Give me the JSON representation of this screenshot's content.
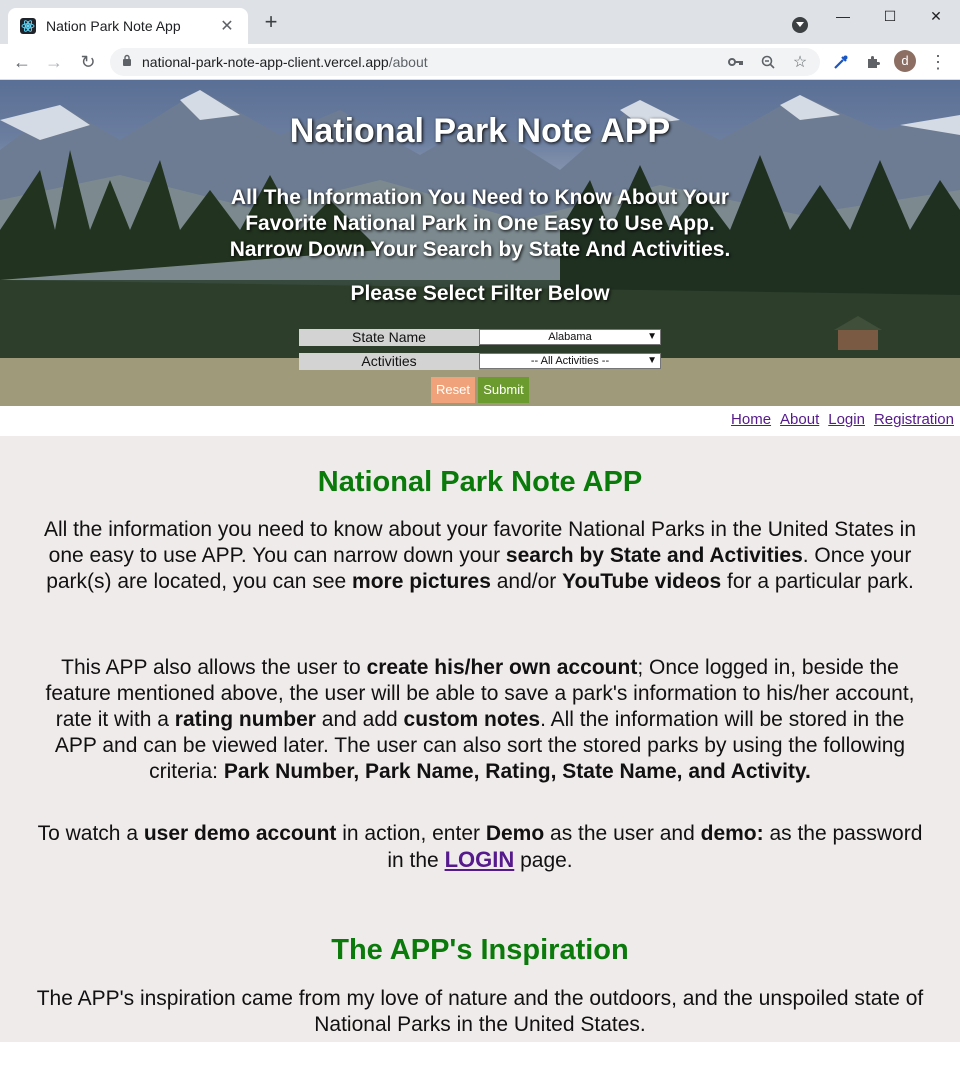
{
  "browser": {
    "tab_title": "Nation Park Note App",
    "url_host": "national-park-note-app-client.vercel.app",
    "url_path": "/about",
    "profile_initial": "d"
  },
  "hero": {
    "title": "National Park Note APP",
    "tagline_lines": [
      "All The Information You Need to Know About Your",
      "Favorite National Park in One Easy to Use App.",
      "Narrow Down Your Search by State And Activities."
    ],
    "filter_heading": "Please Select Filter Below",
    "state_label": "State Name",
    "state_value": "Alabama",
    "activities_label": "Activities",
    "activities_value": "-- All Activities --",
    "reset_label": "Reset",
    "submit_label": "Submit"
  },
  "nav": {
    "home": "Home",
    "about": "About",
    "login": "Login",
    "registration": "Registration"
  },
  "about": {
    "heading": "National Park Note APP",
    "p1": [
      {
        "t": "All the information you need to know about your favorite National Parks in the United States in one easy to use APP. You can narrow down your ",
        "b": false
      },
      {
        "t": "search by State and Activities",
        "b": true
      },
      {
        "t": ". Once your park(s) are located, you can see ",
        "b": false
      },
      {
        "t": "more pictures",
        "b": true
      },
      {
        "t": " and/or ",
        "b": false
      },
      {
        "t": "YouTube videos",
        "b": true
      },
      {
        "t": " for a particular park.",
        "b": false
      }
    ],
    "p2": [
      {
        "t": "This APP also allows the user to ",
        "b": false
      },
      {
        "t": "create his/her own account",
        "b": true
      },
      {
        "t": "; Once logged in, beside the feature mentioned above, the user will be able to save a park's information to his/her account, rate it with a ",
        "b": false
      },
      {
        "t": "rating number",
        "b": true
      },
      {
        "t": " and add ",
        "b": false
      },
      {
        "t": "custom notes",
        "b": true
      },
      {
        "t": ". All the information will be stored in the APP and can be viewed later. The user can also sort the stored parks by using the following criteria: ",
        "b": false
      },
      {
        "t": "Park Number, Park Name, Rating, State Name, and Activity.",
        "b": true
      }
    ],
    "p3_parts": {
      "a": "To watch a ",
      "b": "user demo account",
      "c": " in action, enter ",
      "d": "Demo",
      "e": " as the user and ",
      "f": "demo:",
      "g": " as the password in the ",
      "link": "LOGIN",
      "h": " page."
    },
    "inspiration_heading": "The APP's Inspiration",
    "inspiration_text": "The APP's inspiration came from my love of nature and the outdoors, and the unspoiled state of National Parks in the United States."
  }
}
